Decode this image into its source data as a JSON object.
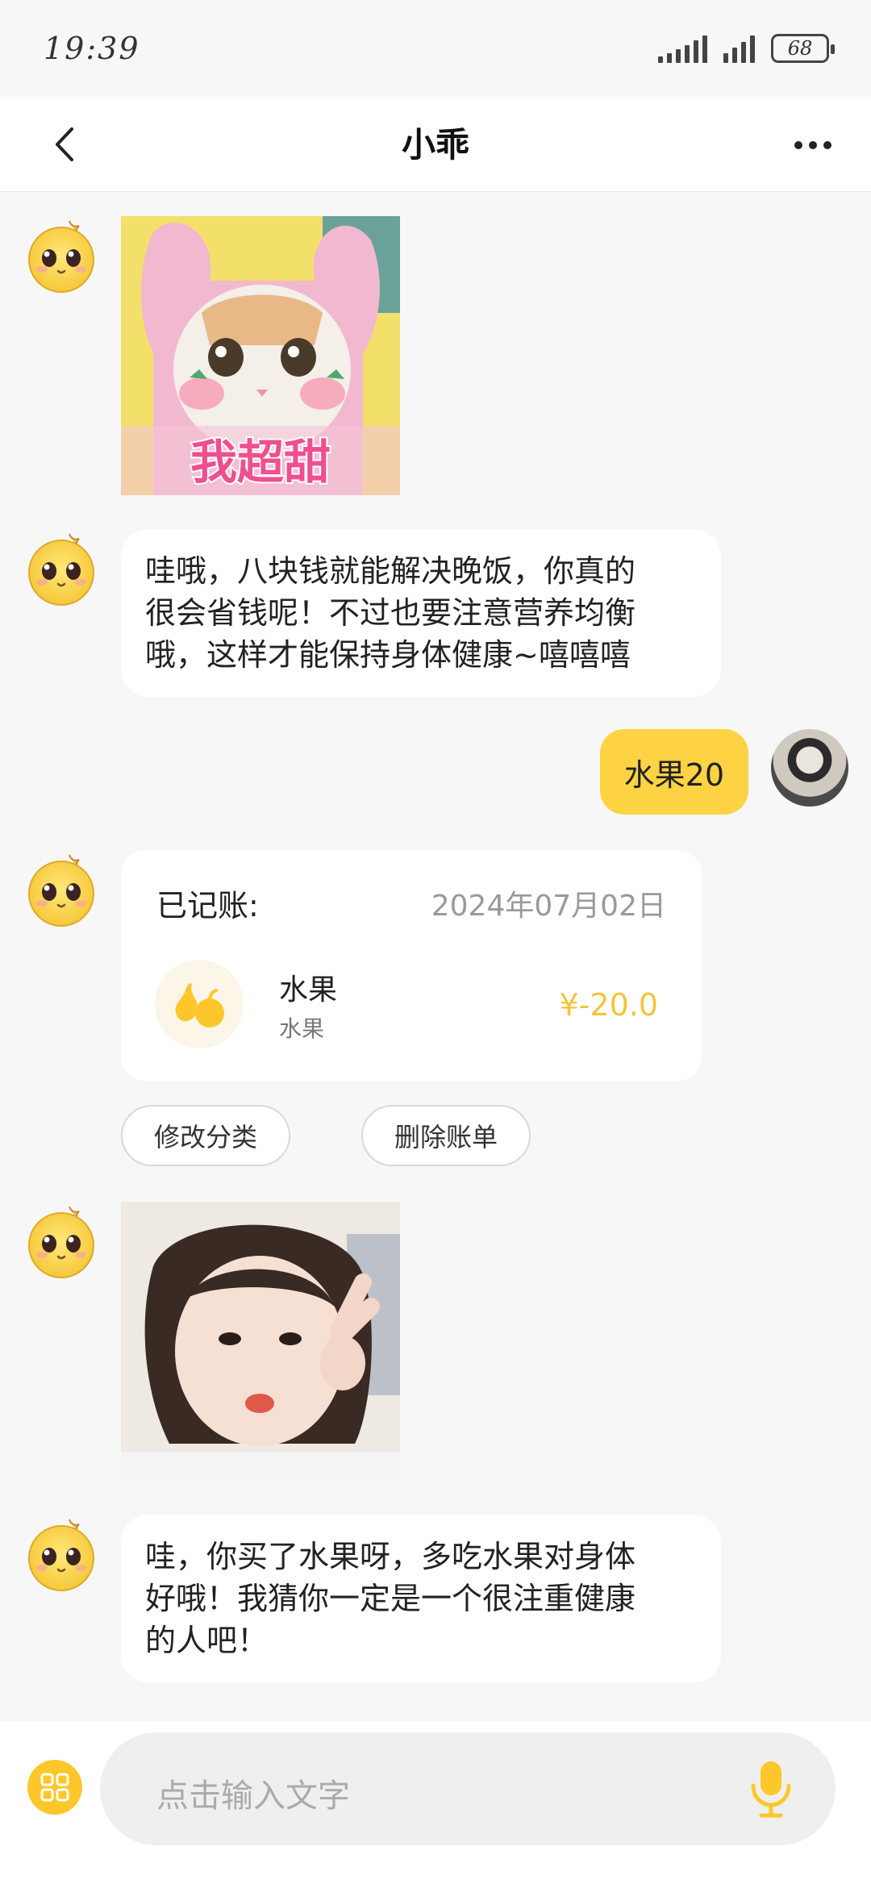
{
  "status_bar": {
    "time": "19:39",
    "battery": "68"
  },
  "header": {
    "title": "小乖"
  },
  "messages": {
    "bot_text_1": "哇哦，八块钱就能解决晚饭，你真的\n很会省钱呢！不过也要注意营养均衡\n哦，这样才能保持身体健康~嘻嘻嘻",
    "user_text_1": "水果20",
    "bot_text_2": "哇，你买了水果呀，多吃水果对身体\n好哦！我猜你一定是一个很注重健康\n的人吧！"
  },
  "sticker_1": {
    "caption": "我超甜"
  },
  "record_card": {
    "title": "已记账:",
    "date": "2024年07月02日",
    "item_name": "水果",
    "item_category": "水果",
    "amount": "¥-20.0"
  },
  "actions": {
    "edit_category": "修改分类",
    "delete_bill": "删除账单"
  },
  "input": {
    "placeholder": "点击输入文字"
  },
  "colors": {
    "accent_yellow": "#fdd343",
    "amount_color": "#f3c43e",
    "background": "#f7f7f8"
  },
  "icons": {
    "back": "chevron-left-icon",
    "more": "more-dots-icon",
    "apps": "apps-grid-icon",
    "mic": "microphone-icon"
  }
}
